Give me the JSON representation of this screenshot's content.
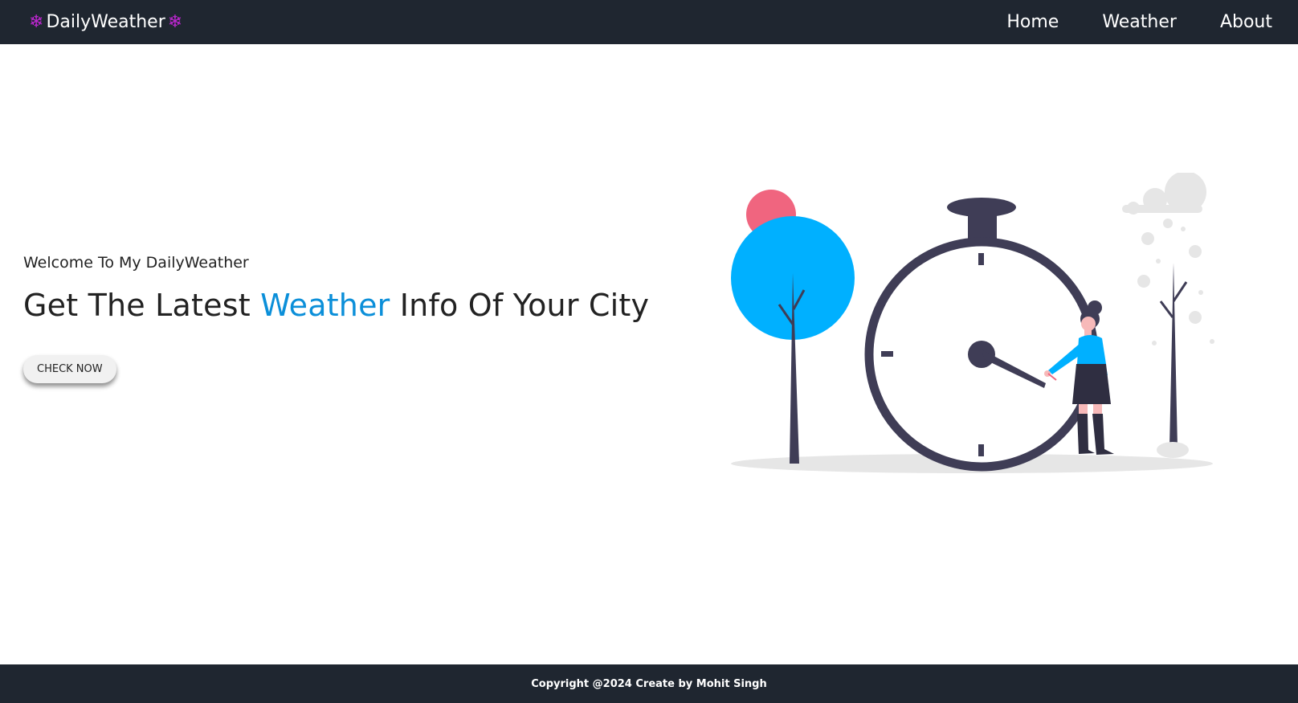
{
  "navbar": {
    "brand_icon": "❄",
    "brand_name": "DailyWeather",
    "links": [
      {
        "label": "Home"
      },
      {
        "label": "Weather"
      },
      {
        "label": "About"
      }
    ],
    "background": "#1f2630"
  },
  "hero": {
    "welcome": "Welcome To My DailyWeather",
    "headline_before": "Get The Latest ",
    "headline_accent": "Weather",
    "headline_after": " Info Of Your City",
    "cta_label": "CHECK NOW",
    "accent_color": "#0b8fd9"
  },
  "illustration": {
    "icon": "stopwatch-woman-trees-illustration",
    "colors": {
      "tree": "#00b0ff",
      "sun": "#f0657f",
      "dark": "#3f3d56",
      "cloud": "#e6e6e6"
    }
  },
  "footer": {
    "text": "Copyright @2024 Create by Mohit Singh"
  }
}
